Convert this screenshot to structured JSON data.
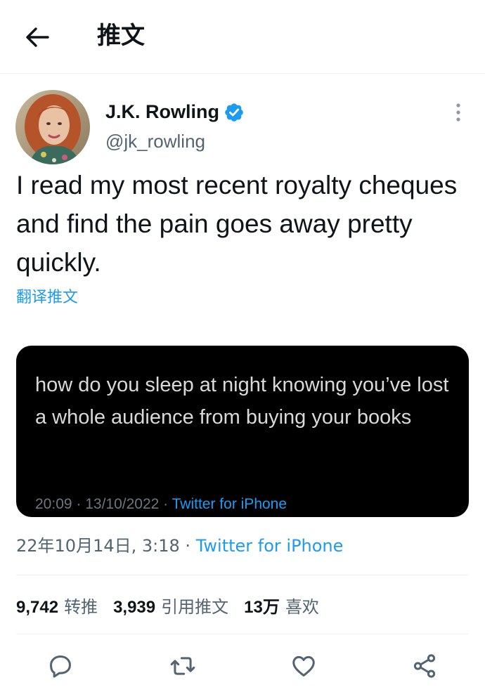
{
  "header": {
    "title": "推文",
    "back_icon": "arrow-left-icon"
  },
  "author": {
    "display_name": "J.K. Rowling",
    "handle": "@jk_rowling",
    "verified": true,
    "verified_color": "#1d9bf0"
  },
  "tweet": {
    "text": "I read my most recent royalty cheques and find the pain goes away pretty quickly.",
    "translate_label": "翻译推文",
    "date": "22年10月14日, 3:18",
    "separator": "·",
    "source": "Twitter for iPhone"
  },
  "media": {
    "text": "how do you sleep at night knowing you’ve lost a whole audience from buying your books",
    "timestamp": "20:09 · 13/10/2022 ·",
    "source": "Twitter for iPhone"
  },
  "stats": {
    "retweets_count": "9,742",
    "retweets_label": "转推",
    "quotes_count": "3,939",
    "quotes_label": "引用推文",
    "likes_count": "13万",
    "likes_label": "喜欢"
  },
  "actions": [
    "reply-icon",
    "retweet-icon",
    "like-icon",
    "share-icon"
  ],
  "colors": {
    "accent": "#1d9bf0",
    "secondary_text": "#536471",
    "primary_text": "#0f1419"
  }
}
